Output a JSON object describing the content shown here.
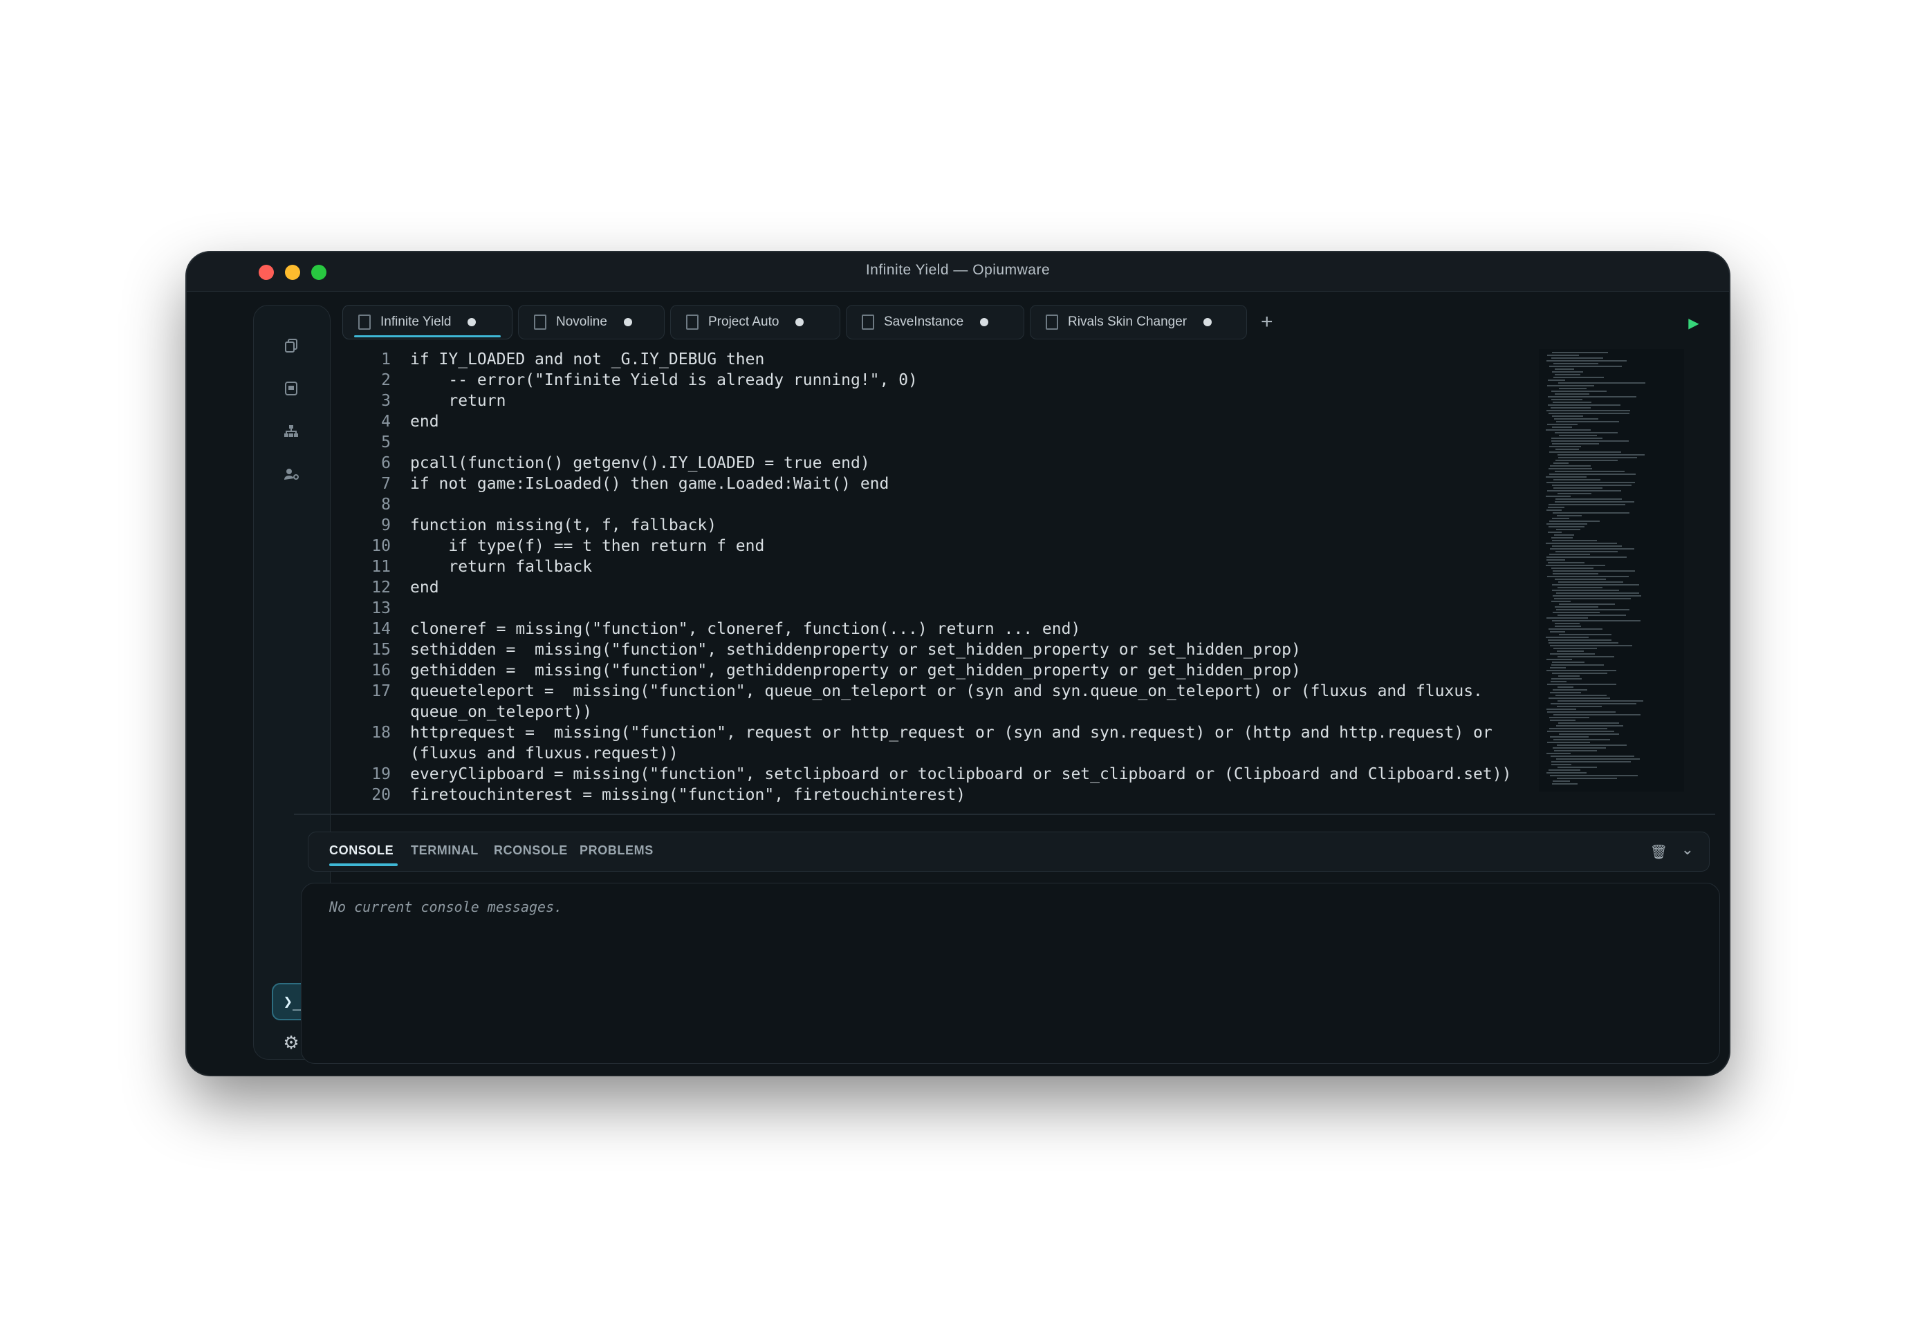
{
  "window": {
    "title": "Infinite Yield — Opiumware"
  },
  "sidebar": {
    "icons": [
      "copy-icon",
      "script-hub-icon",
      "network-icon",
      "account-manager-icon"
    ],
    "terminal_glyph": "❯_",
    "settings_glyph": "⚙"
  },
  "tabs": [
    {
      "label": "Infinite Yield",
      "active": true
    },
    {
      "label": "Novoline",
      "active": false
    },
    {
      "label": "Project Auto",
      "active": false
    },
    {
      "label": "SaveInstance",
      "active": false
    },
    {
      "label": "Rivals Skin Changer",
      "active": false
    }
  ],
  "toolbar": {
    "add_tab": "+",
    "execute_glyph": "▶",
    "open_glyph": "📂",
    "inject_glyph": "⚡"
  },
  "editor": {
    "lines": [
      {
        "n": "1",
        "code": "if IY_LOADED and not _G.IY_DEBUG then"
      },
      {
        "n": "2",
        "code": "    -- error(\"Infinite Yield is already running!\", 0)"
      },
      {
        "n": "3",
        "code": "    return"
      },
      {
        "n": "4",
        "code": "end"
      },
      {
        "n": "5",
        "code": ""
      },
      {
        "n": "6",
        "code": "pcall(function() getgenv().IY_LOADED = true end)"
      },
      {
        "n": "7",
        "code": "if not game:IsLoaded() then game.Loaded:Wait() end"
      },
      {
        "n": "8",
        "code": ""
      },
      {
        "n": "9",
        "code": "function missing(t, f, fallback)"
      },
      {
        "n": "10",
        "code": "    if type(f) == t then return f end"
      },
      {
        "n": "11",
        "code": "    return fallback"
      },
      {
        "n": "12",
        "code": "end"
      },
      {
        "n": "13",
        "code": ""
      },
      {
        "n": "14",
        "code": "cloneref = missing(\"function\", cloneref, function(...) return ... end)"
      },
      {
        "n": "15",
        "code": "sethidden =  missing(\"function\", sethiddenproperty or set_hidden_property or set_hidden_prop)"
      },
      {
        "n": "16",
        "code": "gethidden =  missing(\"function\", gethiddenproperty or get_hidden_property or get_hidden_prop)"
      },
      {
        "n": "17",
        "code": "queueteleport =  missing(\"function\", queue_on_teleport or (syn and syn.queue_on_teleport) or (fluxus and fluxus."
      },
      {
        "n": "",
        "code": "queue_on_teleport))"
      },
      {
        "n": "18",
        "code": "httprequest =  missing(\"function\", request or http_request or (syn and syn.request) or (http and http.request) or"
      },
      {
        "n": "",
        "code": "(fluxus and fluxus.request))"
      },
      {
        "n": "19",
        "code": "everyClipboard = missing(\"function\", setclipboard or toclipboard or set_clipboard or (Clipboard and Clipboard.set))"
      },
      {
        "n": "20",
        "code": "firetouchinterest = missing(\"function\", firetouchinterest)"
      }
    ]
  },
  "panel": {
    "tabs": [
      "CONSOLE",
      "TERMINAL",
      "RCONSOLE",
      "PROBLEMS"
    ],
    "active_tab": "CONSOLE",
    "message": "No current console messages.",
    "trash_glyph": "🗑",
    "collapse_glyph": "⌄"
  }
}
